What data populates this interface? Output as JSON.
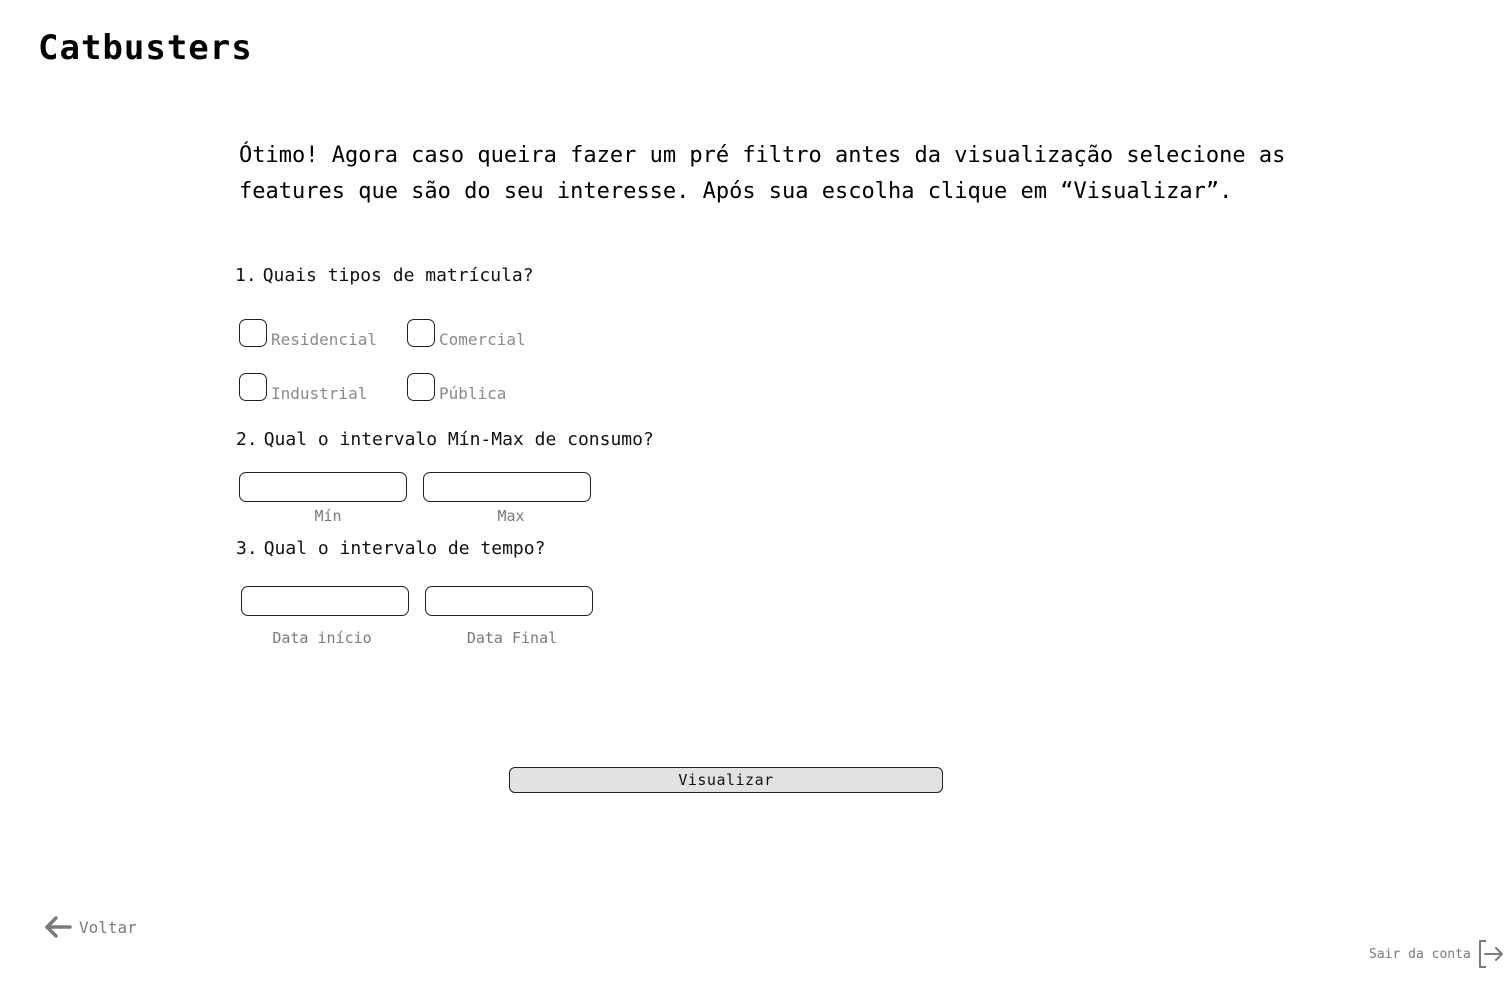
{
  "app": {
    "title": "Catbusters"
  },
  "intro_text": "Ótimo! Agora caso queira fazer um pré filtro antes da visualização selecione as features que são do seu interesse. Após sua escolha clique em “Visualizar”.",
  "questions": {
    "q1": {
      "number": "1.",
      "text": "Quais tipos de matrícula?",
      "options": [
        {
          "label": "Residencial",
          "checked": false
        },
        {
          "label": "Comercial",
          "checked": false
        },
        {
          "label": "Industrial",
          "checked": false
        },
        {
          "label": "Pública",
          "checked": false
        }
      ]
    },
    "q2": {
      "number": "2.",
      "text": "Qual o intervalo Mín-Max de consumo?",
      "min_label": "Mín",
      "max_label": "Max",
      "min_value": "",
      "max_value": ""
    },
    "q3": {
      "number": "3.",
      "text": "Qual o intervalo de tempo?",
      "start_label": "Data início",
      "end_label": "Data Final",
      "start_value": "",
      "end_value": ""
    }
  },
  "actions": {
    "visualize_label": "Visualizar",
    "back_label": "Voltar",
    "logout_label": "Sair da conta"
  },
  "icons": {
    "back": "arrow-left-icon",
    "logout": "logout-icon"
  },
  "colors": {
    "button_bg": "#e2e2e2",
    "muted_text": "#7a7a7a",
    "border": "#222222"
  }
}
